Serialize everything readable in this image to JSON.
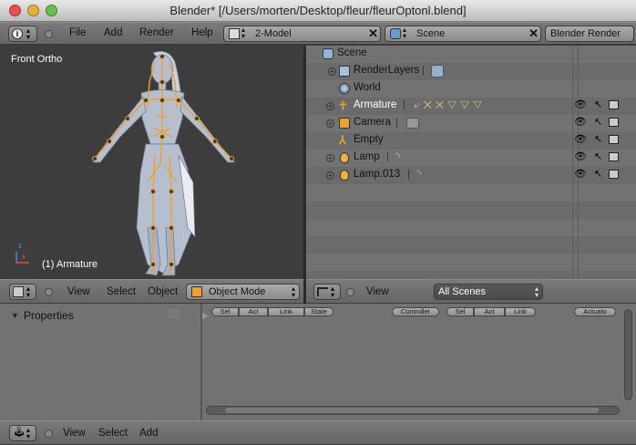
{
  "window": {
    "title": "Blender* [/Users/morten/Desktop/fleur/fleurOptonl.blend]"
  },
  "top_header": {
    "menus": [
      "File",
      "Add",
      "Render",
      "Help"
    ],
    "screen_layout": "2-Model",
    "scene": "Scene",
    "render_engine": "Blender Render"
  },
  "viewport": {
    "label": "Front Ortho",
    "status": "(1) Armature",
    "axes": {
      "x": "x",
      "z": "z"
    }
  },
  "viewport_header": {
    "menus": [
      "View",
      "Select",
      "Object"
    ],
    "mode": "Object Mode"
  },
  "outliner": {
    "items": [
      {
        "label": "Scene",
        "indent": 0,
        "expand": false
      },
      {
        "label": "RenderLayers",
        "indent": 1,
        "expand": true
      },
      {
        "label": "World",
        "indent": 1,
        "expand": false
      },
      {
        "label": "Armature",
        "indent": 1,
        "expand": true,
        "highlight": true
      },
      {
        "label": "Camera",
        "indent": 1,
        "expand": true
      },
      {
        "label": "Empty",
        "indent": 1,
        "expand": false
      },
      {
        "label": "Lamp",
        "indent": 1,
        "expand": true
      },
      {
        "label": "Lamp.013",
        "indent": 1,
        "expand": true
      }
    ]
  },
  "outliner_header": {
    "menu": "View",
    "filter": "All Scenes"
  },
  "properties": {
    "title": "Properties"
  },
  "logic_editor": {
    "sensor_buttons": [
      "Sel",
      "Act",
      "Link",
      "State"
    ],
    "controller_label": "Controller",
    "controller_buttons": [
      "Sel",
      "Act",
      "Link"
    ],
    "actuator_label": "Actuato"
  },
  "bottom_header": {
    "menus": [
      "View",
      "Select",
      "Add"
    ]
  },
  "colors": {
    "highlight": "#f0a030",
    "bg_panel": "#727272"
  }
}
